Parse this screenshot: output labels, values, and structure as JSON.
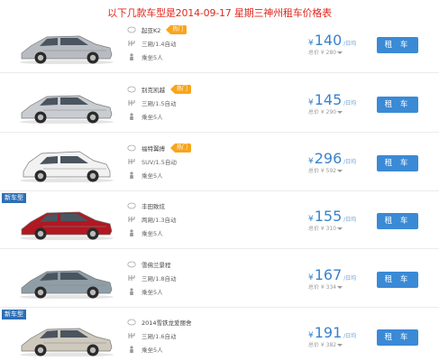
{
  "page": {
    "title": "以下几款车型是2014-09-17 星期三神州租车价格表"
  },
  "colors": {
    "title": "#e0281e",
    "price": "#3a82cc",
    "button": "#3a8ad6",
    "tag": "#f8a51c",
    "badge": "#2d6fb6"
  },
  "cars": [
    {
      "badge": "",
      "name": "起亚K2",
      "tag": "热门",
      "spec": "三厢/1.4自动",
      "seats": "乘坐5人",
      "price": "140",
      "unit": "/日均",
      "sub": "总价 ¥ 280",
      "button": "租 车",
      "car_color": "#b8bcc2"
    },
    {
      "badge": "",
      "name": "别克凯越",
      "tag": "热门",
      "spec": "三厢/1.5自动",
      "seats": "乘坐5人",
      "price": "145",
      "unit": "/日均",
      "sub": "总价 ¥ 290",
      "button": "租 车",
      "car_color": "#c9ccd0"
    },
    {
      "badge": "",
      "name": "福特翼搏",
      "tag": "热门",
      "spec": "SUV/1.5自动",
      "seats": "乘坐5人",
      "price": "296",
      "unit": "/日均",
      "sub": "总价 ¥ 592",
      "button": "租 车",
      "car_color": "#f2f2f2"
    },
    {
      "badge": "新车型",
      "name": "丰田致炫",
      "tag": "",
      "spec": "两厢/1.3自动",
      "seats": "乘坐5人",
      "price": "155",
      "unit": "/日均",
      "sub": "总价 ¥ 310",
      "button": "租 车",
      "car_color": "#b01822"
    },
    {
      "badge": "",
      "name": "雪佛兰景程",
      "tag": "",
      "spec": "三厢/1.8自动",
      "seats": "乘坐5人",
      "price": "167",
      "unit": "/日均",
      "sub": "总价 ¥ 334",
      "button": "租 车",
      "car_color": "#8f9ea6"
    },
    {
      "badge": "新车型",
      "name": "2014雪铁龙爱丽舍",
      "tag": "",
      "spec": "三厢/1.6自动",
      "seats": "乘坐5人",
      "price": "191",
      "unit": "/日均",
      "sub": "总价 ¥ 382",
      "button": "租 车",
      "car_color": "#cfc9bd"
    }
  ]
}
